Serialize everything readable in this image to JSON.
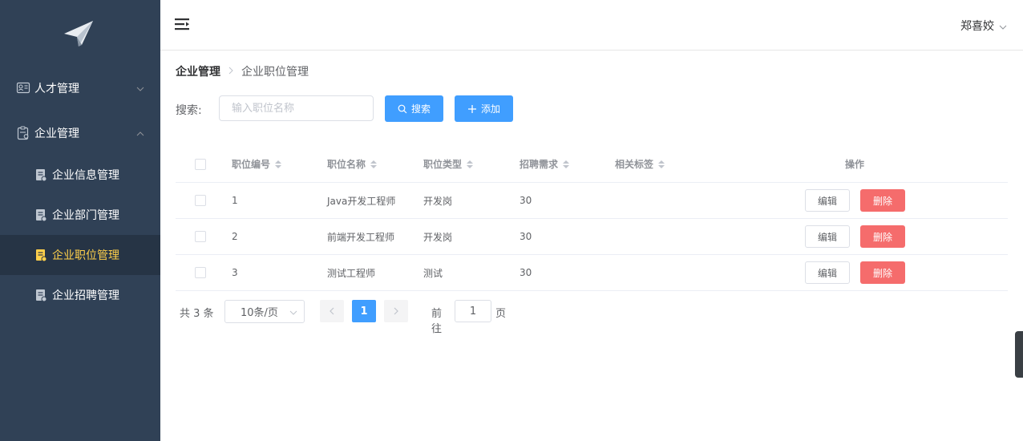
{
  "sidebar": {
    "logo_icon": "paper-plane-icon",
    "items": [
      {
        "label": "人才管理",
        "icon": "id-card-icon",
        "expanded": false
      },
      {
        "label": "企业管理",
        "icon": "clipboard-icon",
        "expanded": true
      }
    ],
    "subitems": [
      {
        "label": "企业信息管理",
        "icon": "doc-icon",
        "active": false
      },
      {
        "label": "企业部门管理",
        "icon": "doc-icon",
        "active": false
      },
      {
        "label": "企业职位管理",
        "icon": "doc-icon",
        "active": true
      },
      {
        "label": "企业招聘管理",
        "icon": "doc-icon",
        "active": false
      }
    ],
    "colors": {
      "bg": "#304156",
      "active_bg": "#263445",
      "active_text": "#ffd04b"
    }
  },
  "header": {
    "user": "郑喜姣"
  },
  "breadcrumb": {
    "first": "企业管理",
    "current": "企业职位管理"
  },
  "search": {
    "label": "搜索:",
    "placeholder": "输入职位名称",
    "value": "",
    "search_button": "搜索",
    "add_button": "添加"
  },
  "table": {
    "columns": [
      "职位编号",
      "职位名称",
      "职位类型",
      "招聘需求",
      "相关标签",
      "操作"
    ],
    "rows": [
      {
        "id": "1",
        "name": "Java开发工程师",
        "type": "开发岗",
        "demand": "30",
        "tags": ""
      },
      {
        "id": "2",
        "name": "前端开发工程师",
        "type": "开发岗",
        "demand": "30",
        "tags": ""
      },
      {
        "id": "3",
        "name": "测试工程师",
        "type": "测试",
        "demand": "30",
        "tags": ""
      }
    ],
    "edit_label": "编辑",
    "delete_label": "删除"
  },
  "pagination": {
    "total": "共 3 条",
    "page_size": "10条/页",
    "current_page": "1",
    "goto_label": "前往",
    "goto_value": "1",
    "page_label": "页"
  },
  "colors": {
    "primary": "#409eff",
    "danger": "#f56c6c"
  }
}
